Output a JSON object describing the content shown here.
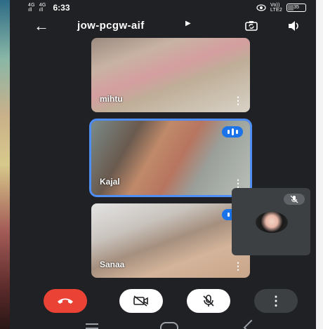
{
  "status_bar": {
    "net1_top": "4G",
    "net1_bottom": "ıll",
    "net2_top": "4G",
    "net2_bottom": "ıll",
    "time": "6:33",
    "signal_top": "Vo))",
    "signal_bottom": "LTE2",
    "battery_level": 0.35,
    "battery_label": "35"
  },
  "header": {
    "title": "jow-pcgw-aif",
    "icons": [
      "back-arrow-icon",
      "caret-right-icon",
      "flip-camera-icon",
      "speaker-icon"
    ]
  },
  "participants": [
    {
      "name": "mihtu",
      "speaking": false
    },
    {
      "name": "Kajal",
      "speaking": true,
      "active": true
    },
    {
      "name": "Sanaa",
      "speaking": true
    }
  ],
  "self_view": {
    "muted": true
  },
  "controls": {
    "buttons": [
      "end-call",
      "camera-off",
      "mic-off",
      "more-options"
    ]
  },
  "colors": {
    "background": "#202124",
    "end_call": "#ea4335",
    "accent": "#1a73e8",
    "tile_highlight": "#4f8ef5"
  }
}
